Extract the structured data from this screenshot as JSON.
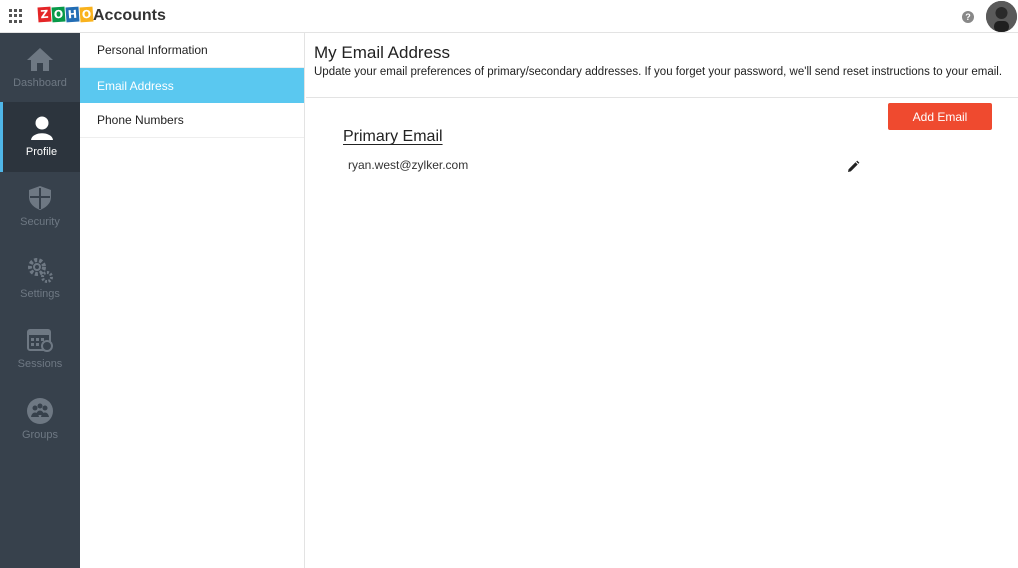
{
  "header": {
    "logo_letters": [
      "Z",
      "O",
      "H",
      "O"
    ],
    "logo_colors": [
      "#e42527",
      "#089949",
      "#226db4",
      "#f9b21d"
    ],
    "app_title": "Accounts",
    "help_glyph": "?"
  },
  "leftnav": {
    "items": [
      {
        "label": "Dashboard",
        "icon": "home-icon",
        "active": false
      },
      {
        "label": "Profile",
        "icon": "user-icon",
        "active": true
      },
      {
        "label": "Security",
        "icon": "shield-icon",
        "active": false
      },
      {
        "label": "Settings",
        "icon": "gears-icon",
        "active": false
      },
      {
        "label": "Sessions",
        "icon": "calendar-icon",
        "active": false
      },
      {
        "label": "Groups",
        "icon": "group-icon",
        "active": false
      }
    ]
  },
  "subnav": {
    "items": [
      {
        "label": "Personal Information",
        "active": false
      },
      {
        "label": "Email Address",
        "active": true
      },
      {
        "label": "Phone Numbers",
        "active": false
      }
    ]
  },
  "main": {
    "title": "My Email Address",
    "description": "Update your email preferences of primary/secondary addresses. If you forget your password, we'll send reset instructions to your email.",
    "add_button_label": "Add Email",
    "section_title": "Primary Email",
    "primary_email": "ryan.west@zylker.com"
  },
  "colors": {
    "accent": "#5ac8f0",
    "button": "#ef4a2f",
    "nav_bg": "#37414c"
  }
}
